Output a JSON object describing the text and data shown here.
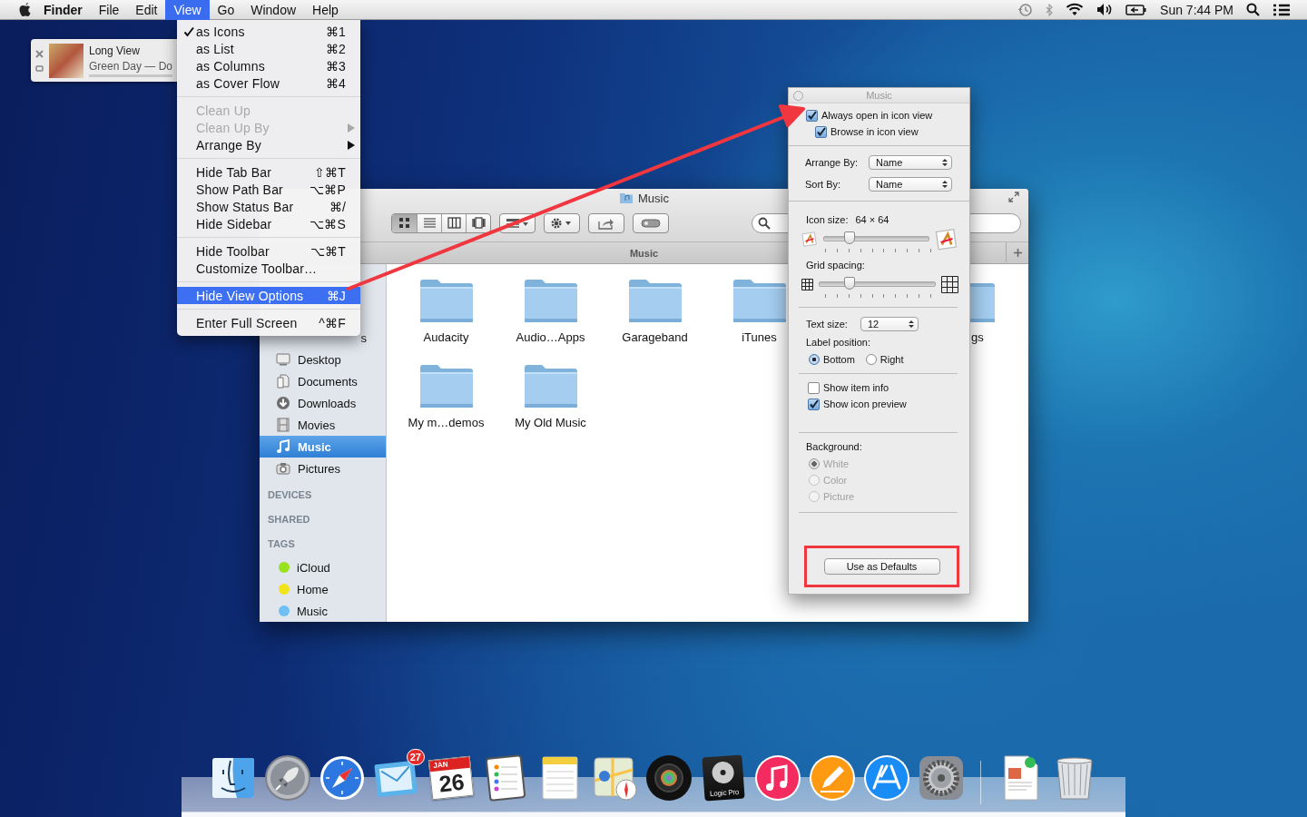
{
  "menu_bar": {
    "app_name": "Finder",
    "menus": [
      {
        "label": "File",
        "selected": false
      },
      {
        "label": "Edit",
        "selected": false
      },
      {
        "label": "View",
        "selected": true
      },
      {
        "label": "Go",
        "selected": false
      },
      {
        "label": "Window",
        "selected": false
      },
      {
        "label": "Help",
        "selected": false
      }
    ],
    "clock": "Sun 7:44 PM"
  },
  "notification": {
    "title": "Long View",
    "subtitle": "Green Day — Do"
  },
  "view_menu": {
    "groups": [
      [
        {
          "label": "as Icons",
          "shortcut": "⌘1",
          "checked": true,
          "disabled": false,
          "submenu": false,
          "selected": false
        },
        {
          "label": "as List",
          "shortcut": "⌘2",
          "checked": false,
          "disabled": false,
          "submenu": false,
          "selected": false
        },
        {
          "label": "as Columns",
          "shortcut": "⌘3",
          "checked": false,
          "disabled": false,
          "submenu": false,
          "selected": false
        },
        {
          "label": "as Cover Flow",
          "shortcut": "⌘4",
          "checked": false,
          "disabled": false,
          "submenu": false,
          "selected": false
        }
      ],
      [
        {
          "label": "Clean Up",
          "checked": false,
          "disabled": true,
          "submenu": false,
          "selected": false
        },
        {
          "label": "Clean Up By",
          "checked": false,
          "disabled": true,
          "submenu": true,
          "selected": false
        },
        {
          "label": "Arrange By",
          "checked": false,
          "disabled": false,
          "submenu": true,
          "selected": false
        }
      ],
      [
        {
          "label": "Hide Tab Bar",
          "shortcut": "⇧⌘T",
          "checked": false,
          "disabled": false,
          "submenu": false,
          "selected": false
        },
        {
          "label": "Show Path Bar",
          "shortcut": "⌥⌘P",
          "checked": false,
          "disabled": false,
          "submenu": false,
          "selected": false
        },
        {
          "label": "Show Status Bar",
          "shortcut": "⌘/",
          "checked": false,
          "disabled": false,
          "submenu": false,
          "selected": false
        },
        {
          "label": "Hide Sidebar",
          "shortcut": "⌥⌘S",
          "checked": false,
          "disabled": false,
          "submenu": false,
          "selected": false
        }
      ],
      [
        {
          "label": "Hide Toolbar",
          "shortcut": "⌥⌘T",
          "checked": false,
          "disabled": false,
          "submenu": false,
          "selected": false
        },
        {
          "label": "Customize Toolbar…",
          "checked": false,
          "disabled": false,
          "submenu": false,
          "selected": false
        }
      ],
      [
        {
          "label": "Hide View Options",
          "shortcut": "⌘J",
          "checked": false,
          "disabled": false,
          "submenu": false,
          "selected": true
        }
      ],
      [
        {
          "label": "Enter Full Screen",
          "shortcut": "^⌘F",
          "checked": false,
          "disabled": false,
          "submenu": false,
          "selected": false
        }
      ]
    ]
  },
  "finder_window": {
    "title": "Music",
    "view_modes": [
      {
        "kind": "icons",
        "selected": true
      },
      {
        "kind": "list",
        "selected": false
      },
      {
        "kind": "columns",
        "selected": false
      },
      {
        "kind": "coverflow",
        "selected": false
      }
    ],
    "path_label": "Music",
    "sidebar": {
      "items": [
        {
          "label": "s",
          "kind": "clipped",
          "selected": false
        },
        {
          "label": "Desktop",
          "kind": "desktop",
          "selected": false
        },
        {
          "label": "Documents",
          "kind": "documents",
          "selected": false
        },
        {
          "label": "Downloads",
          "kind": "downloads",
          "selected": false
        },
        {
          "label": "Movies",
          "kind": "movies",
          "selected": false
        },
        {
          "label": "Music",
          "kind": "music",
          "selected": true
        },
        {
          "label": "Pictures",
          "kind": "pictures",
          "selected": false
        }
      ],
      "sections": [
        "DEVICES",
        "SHARED",
        "TAGS"
      ],
      "tags": [
        {
          "label": "iCloud",
          "color": "#9be21e"
        },
        {
          "label": "Home",
          "color": "#f2e41a"
        },
        {
          "label": "Music",
          "color": "#6ec0f5"
        }
      ]
    },
    "files": [
      {
        "name": "Audacity",
        "kind": "folder"
      },
      {
        "name": "Audio…Apps",
        "kind": "folder"
      },
      {
        "name": "Garageband",
        "kind": "folder"
      },
      {
        "name": "iTunes",
        "kind": "folder"
      },
      {
        "name": "gs",
        "kind": "clipped"
      },
      {
        "name": "My m…demos",
        "kind": "folder"
      },
      {
        "name": "My Old Music",
        "kind": "folder"
      }
    ]
  },
  "view_options": {
    "title": "Music",
    "always_open": {
      "label": "Always open in icon view",
      "checked": true
    },
    "browse": {
      "label": "Browse in icon view",
      "checked": true
    },
    "arrange_by": {
      "label": "Arrange By:",
      "value": "Name"
    },
    "sort_by": {
      "label": "Sort By:",
      "value": "Name"
    },
    "icon_size": {
      "label": "Icon size:",
      "value": "64 × 64",
      "level": 0.24
    },
    "grid_spacing": {
      "label": "Grid spacing:",
      "level": 0.26
    },
    "text_size": {
      "label": "Text size:",
      "value": "12"
    },
    "label_position": {
      "label": "Label position:",
      "options": [
        {
          "label": "Bottom",
          "selected": true
        },
        {
          "label": "Right",
          "selected": false
        }
      ]
    },
    "show_item_info": {
      "label": "Show item info",
      "checked": false
    },
    "show_icon_preview": {
      "label": "Show icon preview",
      "checked": true
    },
    "background": {
      "label": "Background:",
      "options": [
        {
          "label": "White",
          "selected": true,
          "disabled": true
        },
        {
          "label": "Color",
          "selected": false,
          "disabled": true
        },
        {
          "label": "Picture",
          "selected": false,
          "disabled": true
        }
      ]
    },
    "defaults_button": "Use as Defaults"
  },
  "dock": {
    "apps": [
      {
        "kind": "finder"
      },
      {
        "kind": "launchpad"
      },
      {
        "kind": "safari"
      },
      {
        "kind": "mail",
        "badge": "27"
      },
      {
        "kind": "calendar",
        "month": "JAN",
        "day": "26"
      },
      {
        "kind": "reminders"
      },
      {
        "kind": "notes"
      },
      {
        "kind": "maps"
      },
      {
        "kind": "photobooth"
      },
      {
        "kind": "logic",
        "label": "Logic Pro"
      },
      {
        "kind": "itunes"
      },
      {
        "kind": "ibooks"
      },
      {
        "kind": "appstore"
      },
      {
        "kind": "sysprefs"
      }
    ],
    "stacks": [
      {
        "kind": "document"
      },
      {
        "kind": "trash"
      }
    ]
  }
}
